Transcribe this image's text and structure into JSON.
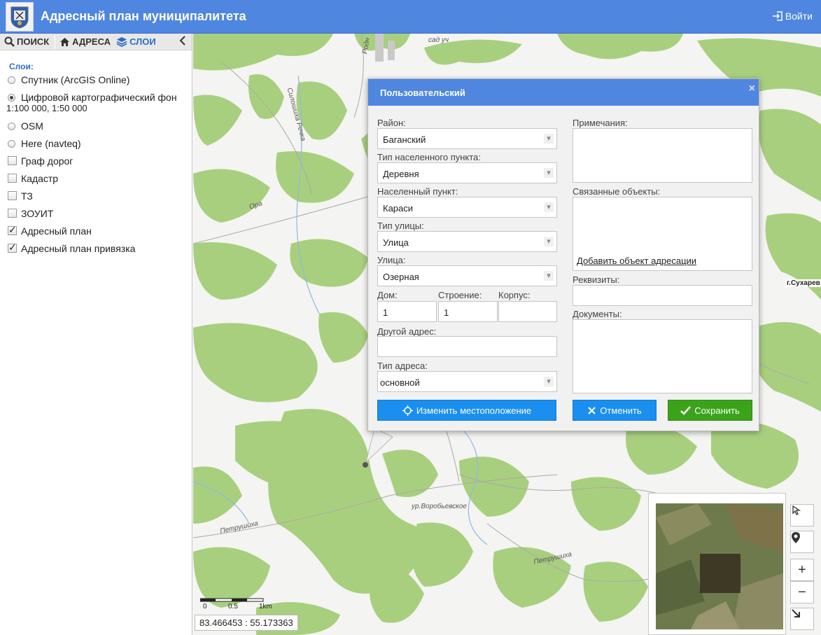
{
  "header": {
    "title": "Адресный план муниципалитета",
    "login": "Войти"
  },
  "sidebar": {
    "tabs": [
      {
        "label": "ПОИСК",
        "icon": "search-icon"
      },
      {
        "label": "АДРЕСА",
        "icon": "home-icon"
      },
      {
        "label": "СЛОИ",
        "icon": "layers-icon",
        "active": true
      }
    ],
    "layers_title": "Слои:",
    "layers": [
      {
        "label": "Спутник (ArcGIS Online)",
        "type": "radio",
        "checked": false
      },
      {
        "label": "Цифровой картографический фон",
        "label2": "1:100 000, 1:50 000",
        "type": "radio",
        "checked": true
      },
      {
        "label": "OSM",
        "type": "radio",
        "checked": false
      },
      {
        "label": "Here (navteq)",
        "type": "radio",
        "checked": false
      },
      {
        "label": "Граф дорог",
        "type": "checkbox",
        "checked": false
      },
      {
        "label": "Кадастр",
        "type": "checkbox",
        "checked": false
      },
      {
        "label": "ТЗ",
        "type": "checkbox",
        "checked": false
      },
      {
        "label": "ЗОУИТ",
        "type": "checkbox",
        "checked": false
      },
      {
        "label": "Адресный план",
        "type": "checkbox",
        "checked": true
      },
      {
        "label": "Адресный план привязка",
        "type": "checkbox",
        "checked": true
      }
    ]
  },
  "map": {
    "labels": {
      "sad": "сад уч",
      "silosh": "Силошиха Речка",
      "ora": "Ора",
      "vorob": "ур.Воробьевское",
      "petr1": "Петрушиха",
      "petr2": "Петрушиха",
      "sukh": "г.Сухарев",
      "rodn": "Родн"
    },
    "scale": {
      "t0": "0",
      "t1": "0.5",
      "t2": "1km"
    },
    "coords": "83.466453 : 55.173363"
  },
  "dialog": {
    "title": "Пользовательский",
    "fields": {
      "district_label": "Район:",
      "district_value": "Баганский",
      "settlement_type_label": "Тип населенного пункта:",
      "settlement_type_value": "Деревня",
      "settlement_label": "Населенный пункт:",
      "settlement_value": "Караси",
      "street_type_label": "Тип улицы:",
      "street_type_value": "Улица",
      "street_label": "Улица:",
      "street_value": "Озерная",
      "house_label": "Дом:",
      "house_value": "1",
      "building_label": "Строение:",
      "building_value": "1",
      "block_label": "Корпус:",
      "block_value": "",
      "other_label": "Другой адрес:",
      "other_value": "",
      "addr_type_label": "Тип адреса:",
      "addr_type_value": "основной",
      "notes_label": "Примечания:",
      "related_label": "Связанные объекты:",
      "add_object_link": "Добавить объект адресации",
      "requisites_label": "Реквизиты:",
      "documents_label": "Документы:"
    },
    "buttons": {
      "relocate": "Изменить местоположение",
      "cancel": "Отменить",
      "save": "Сохранить"
    }
  },
  "colors": {
    "header": "#4f86e0",
    "forest": "#a8cf7e",
    "button_blue": "#1a8ff0",
    "button_green": "#3aa31a"
  }
}
